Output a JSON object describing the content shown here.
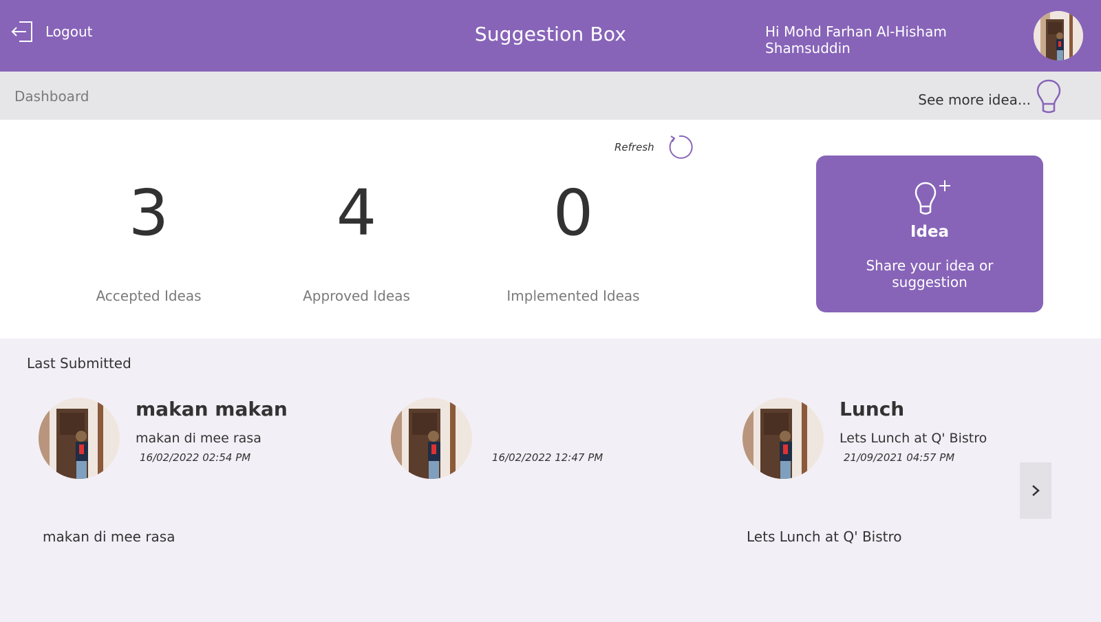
{
  "header": {
    "logout_label": "Logout",
    "title": "Suggestion Box",
    "greeting": "Hi Mohd Farhan Al-Hisham Shamsuddin"
  },
  "subbar": {
    "breadcrumb": "Dashboard",
    "see_more_label": "See more idea..."
  },
  "stats": {
    "refresh_label": "Refresh",
    "items": [
      {
        "value": "3",
        "label": "Accepted Ideas"
      },
      {
        "value": "4",
        "label": "Approved Ideas"
      },
      {
        "value": "0",
        "label": "Implemented Ideas"
      }
    ]
  },
  "idea_card": {
    "title": "Idea",
    "subtitle": "Share your idea or suggestion"
  },
  "last_submitted": {
    "heading": "Last Submitted",
    "cards": [
      {
        "title": "makan makan",
        "description": "makan di mee rasa",
        "date": "16/02/2022 02:54 PM",
        "body": "makan di mee rasa"
      },
      {
        "title": "",
        "description": "",
        "date": "16/02/2022 12:47 PM",
        "body": ""
      },
      {
        "title": "Lunch",
        "description": "Lets Lunch at Q' Bistro",
        "date": "21/09/2021 04:57 PM",
        "body": "Lets Lunch at Q' Bistro"
      }
    ]
  },
  "colors": {
    "brand": "#8764b8",
    "subbar": "#e6e6e8",
    "section_bg": "#f2eff6"
  },
  "icons": [
    "logout-icon",
    "lightbulb-icon",
    "refresh-icon",
    "lightbulb-plus-icon",
    "chevron-right-icon"
  ]
}
